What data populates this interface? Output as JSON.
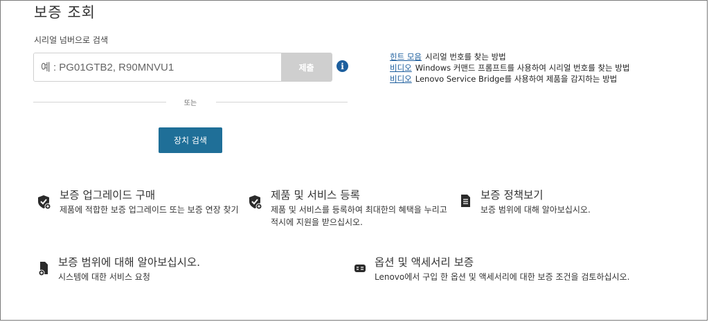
{
  "page": {
    "title": "보증 조회",
    "serial_label": "시리얼 넘버으로 검색",
    "search_placeholder": "예 : PG01GTB2, R90MNVU1",
    "submit_label": "제출",
    "info_icon": "i",
    "divider_text": "또는",
    "device_search_label": "장치 검색"
  },
  "help_links": [
    {
      "link": "힌트 모음",
      "text": "시리얼 번호를 찾는 방법"
    },
    {
      "link": "비디오",
      "text": "Windows 커맨드 프롬프트를 사용하여 시리얼 번호를 찾는 방법"
    },
    {
      "link": "비디오",
      "text": "Lenovo Service Bridge를 사용하여 제품을 감지하는 방법"
    }
  ],
  "features": [
    {
      "icon": "shield-check-icon",
      "title": "보증 업그레이드 구매",
      "desc": "제품에 적합한 보증 업그레이드 또는 보증 연장 찾기"
    },
    {
      "icon": "shield-check-icon",
      "title": "제품 및 서비스 등록",
      "desc": "제품 및 서비스를 등록하여 최대한의 혜택을 누리고 적시에 지원을 받으십시오."
    },
    {
      "icon": "document-icon",
      "title": "보증 정책보기",
      "desc": "보증 범위에 대해 알아보십시오."
    },
    {
      "icon": "document-add-icon",
      "title": "보증 범위에 대해 알아보십시오.",
      "desc": "시스템에 대한 서비스 요청"
    },
    {
      "icon": "accessory-icon",
      "title": "옵션 및 액세서리 보증",
      "desc": "Lenovo에서 구입 한 옵션 및 액세서리에 대한 보증 조건을 검토하십시오."
    }
  ]
}
